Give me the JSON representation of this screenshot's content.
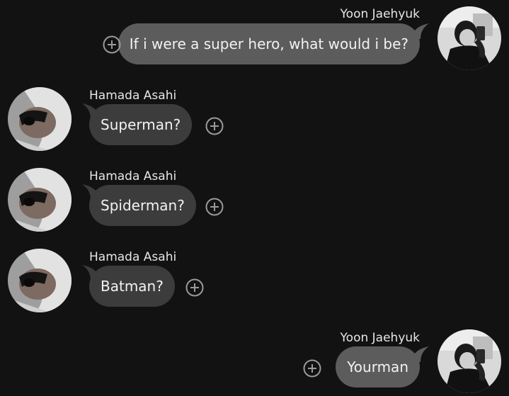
{
  "colors": {
    "background": "#121212",
    "sent_bubble": "#5c5c5c",
    "received_bubble": "#3c3c3c",
    "text": "#f2f2f2",
    "name_text": "#e6e6e6"
  },
  "messages": [
    {
      "sender": "Yoon Jaehyuk",
      "text": "If i were a super hero, what would i be?",
      "direction": "sent",
      "react_icon": "add-reaction-icon"
    },
    {
      "sender": "Hamada Asahi",
      "text": "Superman?",
      "direction": "received",
      "react_icon": "add-reaction-icon"
    },
    {
      "sender": "Hamada Asahi",
      "text": "Spiderman?",
      "direction": "received",
      "react_icon": "add-reaction-icon"
    },
    {
      "sender": "Hamada Asahi",
      "text": "Batman?",
      "direction": "received",
      "react_icon": "add-reaction-icon"
    },
    {
      "sender": "Yoon Jaehyuk",
      "text": "Yourman",
      "direction": "sent",
      "react_icon": "add-reaction-icon"
    }
  ]
}
